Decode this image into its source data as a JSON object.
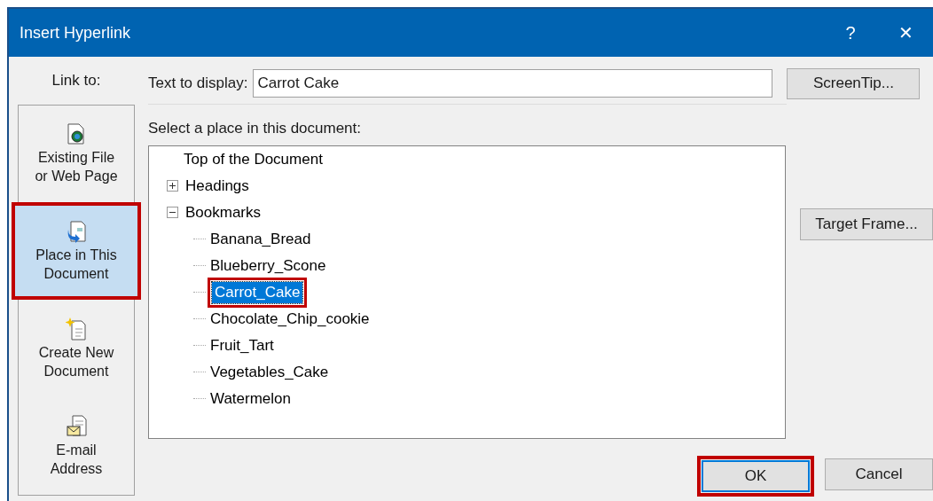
{
  "window": {
    "title": "Insert Hyperlink",
    "controls": [
      "?",
      "✕"
    ]
  },
  "link_to": {
    "label": "Link to:",
    "items": [
      {
        "label": "Existing File or Web Page",
        "selected": false,
        "highlighted": false
      },
      {
        "label": "Place in This Document",
        "selected": true,
        "highlighted": true
      },
      {
        "label": "Create New Document",
        "selected": false,
        "highlighted": false
      },
      {
        "label": "E-mail Address",
        "selected": false,
        "highlighted": false
      }
    ]
  },
  "text_to_display": {
    "label": "Text to display:",
    "value": "Carrot Cake"
  },
  "place": {
    "label": "Select a place in this document:",
    "tree": [
      {
        "label": "Top of the Document",
        "selected": false,
        "highlighted": false
      },
      {
        "label": "Headings",
        "expanded": false,
        "selected": false,
        "highlighted": false
      },
      {
        "label": "Bookmarks",
        "expanded": true,
        "selected": false,
        "highlighted": false,
        "children": [
          {
            "label": "Banana_Bread",
            "selected": false,
            "highlighted": false
          },
          {
            "label": "Blueberry_Scone",
            "selected": false,
            "highlighted": false
          },
          {
            "label": "Carrot_Cake",
            "selected": true,
            "highlighted": true
          },
          {
            "label": "Chocolate_Chip_cookie",
            "selected": false,
            "highlighted": false
          },
          {
            "label": "Fruit_Tart",
            "selected": false,
            "highlighted": false
          },
          {
            "label": "Vegetables_Cake",
            "selected": false,
            "highlighted": false
          },
          {
            "label": "Watermelon",
            "selected": false,
            "highlighted": false
          }
        ]
      }
    ]
  },
  "side_buttons": [
    "ScreenTip...",
    "Target Frame..."
  ],
  "buttons": [
    {
      "label": "OK",
      "default": true,
      "highlighted": true
    },
    {
      "label": "Cancel",
      "default": false,
      "highlighted": false
    }
  ]
}
